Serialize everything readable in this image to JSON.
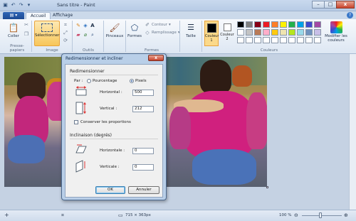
{
  "window": {
    "title": "Sans titre - Paint",
    "quick_access": [
      "save-icon",
      "undo-icon",
      "redo-icon",
      "dropdown-icon"
    ],
    "controls": {
      "minimize": "–",
      "maximize": "□",
      "close": "x"
    }
  },
  "tabs": {
    "file_menu": "▤ ▾",
    "items": [
      "Accueil",
      "Affichage"
    ],
    "active": "Accueil",
    "help": "?"
  },
  "ribbon": {
    "clipboard": {
      "paste_label": "Coller",
      "group_label": "Presse-papiers"
    },
    "image": {
      "select_label": "Sélectionner",
      "group_label": "Image"
    },
    "tools": {
      "group_label": "Outils",
      "text_tool": "A"
    },
    "brushes": {
      "label": "Pinceaux"
    },
    "shapes": {
      "shapes_label": "Formes",
      "outline_label": "Contour",
      "fill_label": "Remplissage",
      "group_label": "Formes"
    },
    "size": {
      "label": "Taille"
    },
    "colors": {
      "color1_label": "Couleur 1",
      "color2_label": "Couleur 2",
      "edit_label": "Modifier les couleurs",
      "group_label": "Couleurs",
      "color1": "#000000",
      "color2": "#ffffff",
      "palette": [
        "#000000",
        "#7f7f7f",
        "#880015",
        "#ed1c24",
        "#ff7f27",
        "#fff200",
        "#22b14c",
        "#00a2e8",
        "#3f48cc",
        "#a349a4",
        "#ffffff",
        "#c3c3c3",
        "#b97a57",
        "#ffaec9",
        "#ffc90e",
        "#efe4b0",
        "#b5e61d",
        "#99d9ea",
        "#7092be",
        "#c8bfe7",
        "#ffffff",
        "#ffffff",
        "#ffffff",
        "#ffffff",
        "#ffffff",
        "#ffffff",
        "#ffffff",
        "#ffffff",
        "#ffffff",
        "#ffffff"
      ]
    }
  },
  "dialog": {
    "title": "Redimensionner et incliner",
    "close": "x",
    "resize_section": "Redimensionner",
    "by_label": "Par :",
    "percent_label": "Pourcentage",
    "pixels_label": "Pixels",
    "selected_unit": "Pixels",
    "horizontal_label": "Horizontal :",
    "horizontal_value": "500",
    "vertical_label": "Vertical :",
    "vertical_value": "212",
    "keep_ratio_label": "Conserver les proportions",
    "keep_ratio_checked": false,
    "skew_section": "Inclinaison (degrés)",
    "skew_h_label": "Horizontale :",
    "skew_h_value": "0",
    "skew_v_label": "Verticale :",
    "skew_v_value": "0",
    "ok_label": "OK",
    "cancel_label": "Annuler"
  },
  "statusbar": {
    "add_icon": "+",
    "selection_icon": "⌗",
    "size_text": "715 × 363px",
    "zoom_text": "100 %",
    "zoom_level_percent": 100,
    "zoom_out": "⊖",
    "zoom_in": "⊕"
  }
}
